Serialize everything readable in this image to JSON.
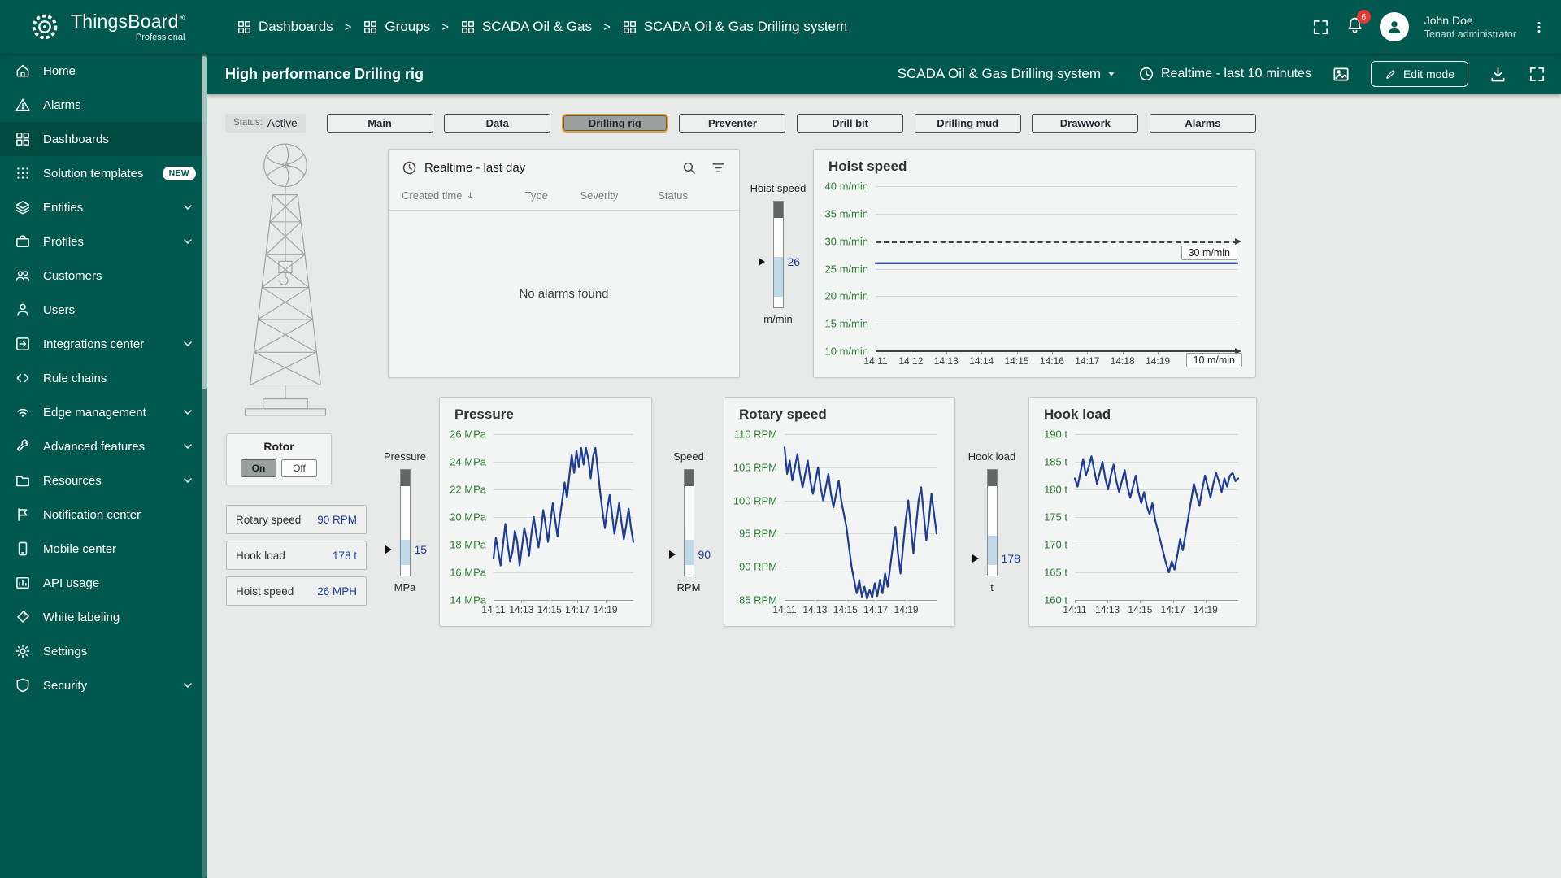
{
  "colors": {
    "sidebar_teal": "#00584e",
    "active_item": "#004c42",
    "selected_outline": "#e0a23b",
    "chart_line": "#1e3c96",
    "tick_green": "#2e7d32",
    "value_blue": "#1c3e9f",
    "badge_red": "#e53935"
  },
  "header": {
    "logo_title": "ThingsBoard",
    "logo_subtitle": "Professional",
    "breadcrumb": [
      "Dashboards",
      "Groups",
      "SCADA Oil & Gas",
      "SCADA Oil & Gas Drilling system"
    ],
    "notifications_count": "6",
    "user_name": "John Doe",
    "user_role": "Tenant administrator"
  },
  "sidebar": {
    "items": [
      {
        "label": "Home",
        "icon": "home-icon"
      },
      {
        "label": "Alarms",
        "icon": "alarms-icon"
      },
      {
        "label": "Dashboards",
        "icon": "dashboards-icon",
        "active": true
      },
      {
        "label": "Solution templates",
        "icon": "solution-templates-icon",
        "badge": "NEW"
      },
      {
        "label": "Entities",
        "icon": "entities-icon",
        "expandable": true
      },
      {
        "label": "Profiles",
        "icon": "profiles-icon",
        "expandable": true
      },
      {
        "label": "Customers",
        "icon": "customers-icon"
      },
      {
        "label": "Users",
        "icon": "users-icon"
      },
      {
        "label": "Integrations center",
        "icon": "integrations-center-icon",
        "expandable": true
      },
      {
        "label": "Rule chains",
        "icon": "rule-chains-icon"
      },
      {
        "label": "Edge management",
        "icon": "edge-management-icon",
        "expandable": true
      },
      {
        "label": "Advanced features",
        "icon": "advanced-features-icon",
        "expandable": true
      },
      {
        "label": "Resources",
        "icon": "resources-icon",
        "expandable": true
      },
      {
        "label": "Notification center",
        "icon": "notification-center-icon"
      },
      {
        "label": "Mobile center",
        "icon": "mobile-center-icon"
      },
      {
        "label": "API usage",
        "icon": "api-usage-icon"
      },
      {
        "label": "White labeling",
        "icon": "white-labeling-icon"
      },
      {
        "label": "Settings",
        "icon": "settings-icon"
      },
      {
        "label": "Security",
        "icon": "security-icon",
        "expandable": true
      }
    ]
  },
  "toolbar": {
    "title": "High performance Driling rig",
    "state_select": "SCADA Oil & Gas Drilling system",
    "time_window": "Realtime - last 10 minutes",
    "edit_button": "Edit mode"
  },
  "statusbar": {
    "status_label": "Status:",
    "status_value": "Active",
    "buttons": [
      {
        "label": "Main",
        "selected": false
      },
      {
        "label": "Data",
        "selected": false
      },
      {
        "label": "Drilling rig",
        "selected": true
      },
      {
        "label": "Preventer",
        "selected": false
      },
      {
        "label": "Drill bit",
        "selected": false
      },
      {
        "label": "Drilling mud",
        "selected": false
      },
      {
        "label": "Drawwork",
        "selected": false
      },
      {
        "label": "Alarms",
        "selected": false
      }
    ]
  },
  "alarms_panel": {
    "time_window": "Realtime - last day",
    "columns": [
      "Created time",
      "Type",
      "Severity",
      "Status"
    ],
    "empty_message": "No alarms found"
  },
  "rotor": {
    "title": "Rotor",
    "on": "On",
    "off": "Off",
    "state": "On"
  },
  "info_cards": [
    {
      "label": "Rotary speed",
      "value": "90 RPM"
    },
    {
      "label": "Hook load",
      "value": "178 t"
    },
    {
      "label": "Hoist speed",
      "value": "26 MPH"
    }
  ],
  "gauges": [
    {
      "title": "Hoist speed",
      "value": "26",
      "unit": "m/min",
      "min": 0,
      "max": 60,
      "num": 26
    },
    {
      "title": "Pressure",
      "value": "15",
      "unit": "MPa",
      "min": 10,
      "max": 30,
      "num": 15
    },
    {
      "title": "Speed",
      "value": "90",
      "unit": "RPM",
      "min": 80,
      "max": 130,
      "num": 90
    },
    {
      "title": "Hook load",
      "value": "178",
      "unit": "t",
      "min": 160,
      "max": 270,
      "num": 178
    }
  ],
  "chart_data": [
    {
      "id": "hoist-speed",
      "type": "line",
      "title": "Hoist speed",
      "ylim": [
        10,
        40
      ],
      "yticks": [
        40,
        35,
        30,
        25,
        20,
        15,
        10
      ],
      "ytick_suffix": " m/min",
      "xticks": [
        "14:11",
        "14:12",
        "14:13",
        "14:14",
        "14:15",
        "14:16",
        "14:17",
        "14:18",
        "14:19"
      ],
      "threshold": 30,
      "threshold_label": "30 m/min",
      "axis_value": 10,
      "axis_label": "10 m/min",
      "line_color": "#1e3c96",
      "points": [
        26,
        26
      ]
    },
    {
      "id": "pressure",
      "type": "line",
      "title": "Pressure",
      "ylim": [
        14,
        26
      ],
      "yticks": [
        26,
        24,
        22,
        20,
        18,
        16,
        14
      ],
      "ytick_suffix": " MPa",
      "xticks": [
        "14:11",
        "14:13",
        "14:15",
        "14:17",
        "14:19"
      ],
      "line_color": "#1e3c96",
      "points": [
        17,
        18.5,
        17.5,
        16.5,
        18,
        19.5,
        18,
        16.8,
        17.5,
        19,
        18.2,
        16.5,
        17.8,
        19.2,
        18.4,
        17.2,
        18.8,
        20,
        18.8,
        17.8,
        19,
        20.5,
        19.4,
        18.2,
        19.6,
        21,
        19.8,
        18.6,
        20,
        21.2,
        22.5,
        21.4,
        23,
        24.5,
        23.2,
        24.8,
        23.6,
        25,
        23.8,
        25,
        24.2,
        22.8,
        24.4,
        25,
        23.4,
        21.8,
        20.4,
        19.2,
        20.6,
        21.6,
        20.2,
        18.8,
        19.8,
        21,
        19.6,
        18.4,
        19.4,
        20.6,
        19.2,
        18.2
      ]
    },
    {
      "id": "rotary-speed",
      "type": "line",
      "title": "Rotary speed",
      "ylim": [
        85,
        110
      ],
      "yticks": [
        110,
        105,
        100,
        95,
        90,
        85
      ],
      "ytick_suffix": " RPM",
      "xticks": [
        "14:11",
        "14:13",
        "14:15",
        "14:17",
        "14:19"
      ],
      "line_color": "#1e3c96",
      "points": [
        108,
        104,
        106,
        103,
        105,
        107,
        104,
        102,
        104,
        106,
        103,
        101,
        103,
        105,
        102,
        100,
        102,
        104,
        101,
        99,
        101,
        103,
        100,
        98,
        96,
        93,
        90,
        88,
        86,
        88,
        85.5,
        87,
        85.2,
        86.5,
        85.4,
        87.5,
        85.6,
        88,
        86,
        89,
        87,
        90,
        93,
        96,
        92,
        89,
        93,
        97,
        100,
        96,
        92,
        96,
        100,
        102,
        98,
        94,
        97,
        101,
        98,
        95
      ]
    },
    {
      "id": "hook-load",
      "type": "line",
      "title": "Hook load",
      "ylim": [
        160,
        190
      ],
      "yticks": [
        190,
        185,
        180,
        175,
        170,
        165,
        160
      ],
      "ytick_suffix": " t",
      "xticks": [
        "14:11",
        "14:13",
        "14:15",
        "14:17",
        "14:19"
      ],
      "line_color": "#1e3c96",
      "points": [
        182,
        180.5,
        183,
        185.5,
        182.5,
        184,
        186,
        183.5,
        181,
        183,
        185,
        182,
        180,
        182.5,
        184.5,
        181.5,
        179.5,
        181.5,
        183.5,
        180.5,
        178.5,
        180.5,
        182.5,
        179.5,
        177.5,
        179.5,
        177,
        175.5,
        177.5,
        174.5,
        172.5,
        170.5,
        168.5,
        166.5,
        165,
        167,
        165.5,
        168,
        171,
        169,
        172,
        175,
        178,
        181,
        179,
        177,
        180,
        182.5,
        180.5,
        178.5,
        181,
        183,
        181.5,
        179.5,
        182,
        180.5,
        182.5,
        183,
        181.5,
        182
      ]
    }
  ]
}
